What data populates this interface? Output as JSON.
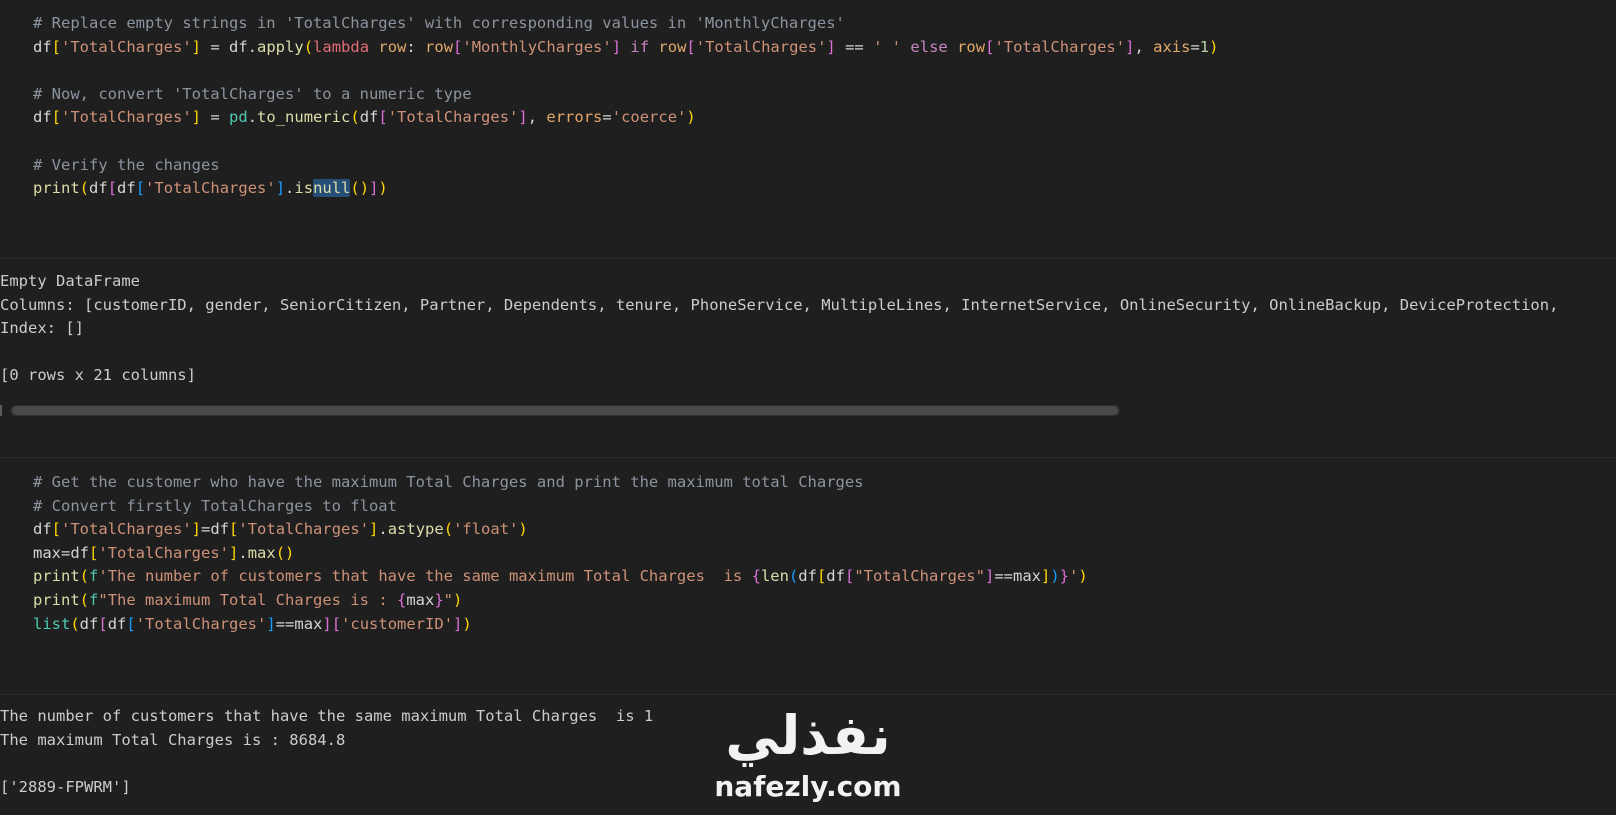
{
  "cell1": {
    "lines": [
      "# Replace empty strings in 'TotalCharges' with corresponding values in 'MonthlyCharges'",
      "df['TotalCharges'] = df.apply(lambda row: row['MonthlyCharges'] if row['TotalCharges'] == ' ' else row['TotalCharges'], axis=1)",
      "",
      "# Now, convert 'TotalCharges' to a numeric type",
      "df['TotalCharges'] = pd.to_numeric(df['TotalCharges'], errors='coerce')",
      "",
      "# Verify the changes",
      "print(df[df['TotalCharges'].isnull()])"
    ]
  },
  "output1": {
    "lines": [
      "Empty DataFrame",
      "Columns: [customerID, gender, SeniorCitizen, Partner, Dependents, tenure, PhoneService, MultipleLines, InternetService, OnlineSecurity, OnlineBackup, DeviceProtection,",
      "Index: []",
      "",
      "[0 rows x 21 columns]"
    ]
  },
  "cell2": {
    "lines": [
      "# Get the customer who have the maximum Total Charges and print the maximum total Charges",
      "# Convert firstly TotalCharges to float",
      "df['TotalCharges']=df['TotalCharges'].astype('float')",
      "max=df['TotalCharges'].max()",
      "print(f'The number of customers that have the same maximum Total Charges  is {len(df[df[\"TotalCharges\"]==max])}')",
      "print(f\"The maximum Total Charges is : {max}\")",
      "list(df[df['TotalCharges']==max]['customerID'])"
    ]
  },
  "output2": {
    "lines": [
      "The number of customers that have the same maximum Total Charges  is 1",
      "The maximum Total Charges is : 8684.8",
      "",
      "['2889-FPWRM']"
    ]
  },
  "watermark": {
    "arabic": "نفذلي",
    "latin": "nafezly.com"
  },
  "colors": {
    "background": "#1f1f1f",
    "comment": "#8b949e",
    "string": "#ce9178",
    "function": "#dcdcaa",
    "keyword": "#c586c0",
    "variable": "#9cdcfe"
  }
}
